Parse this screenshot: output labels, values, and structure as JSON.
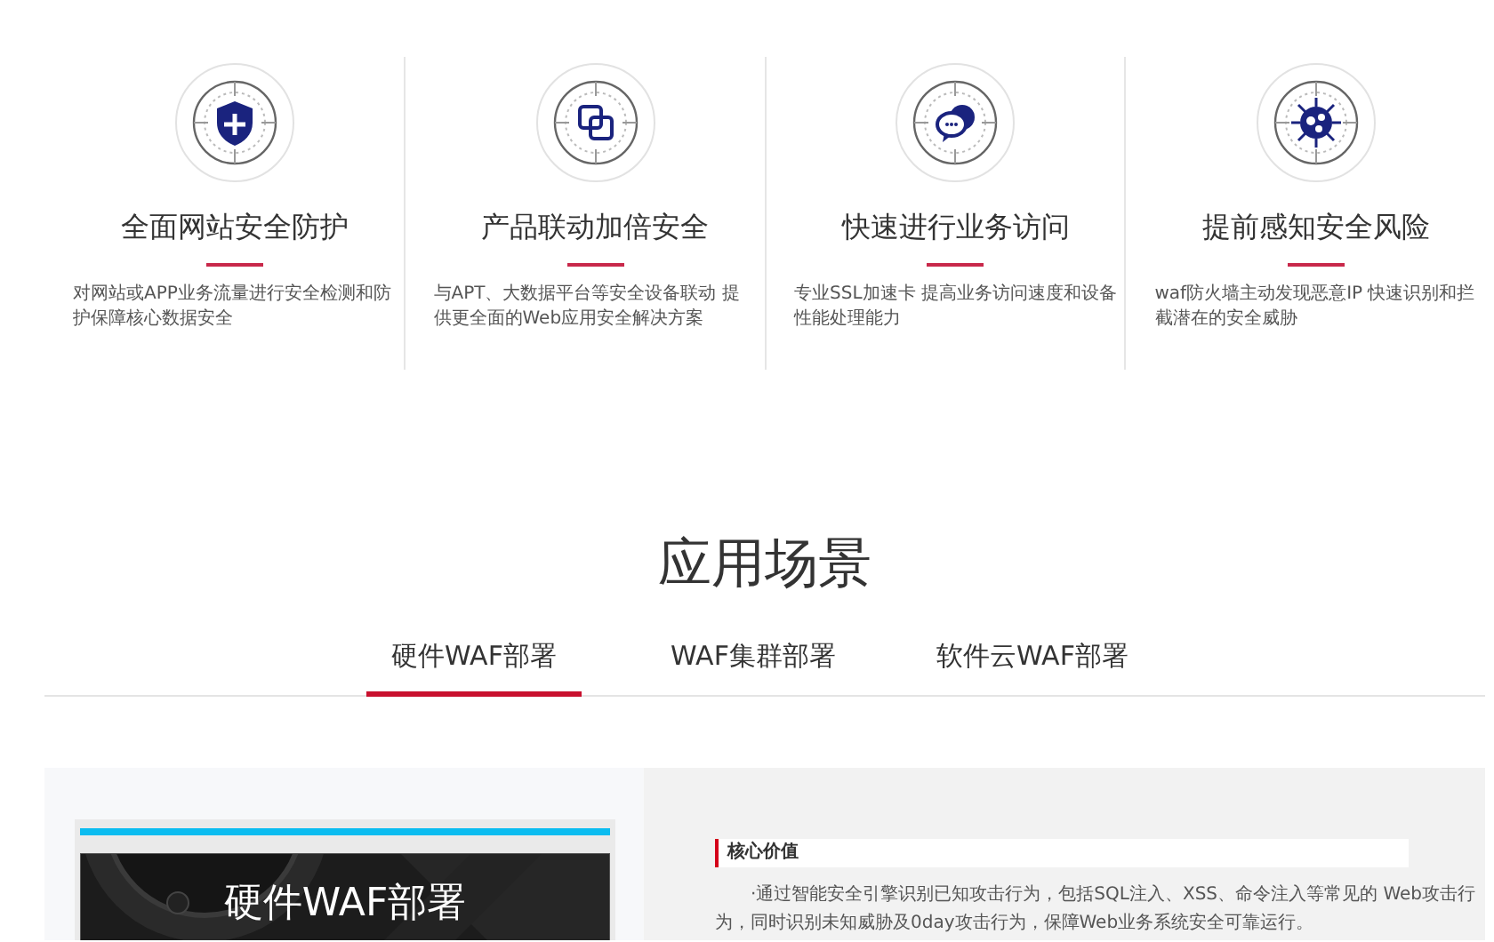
{
  "features": [
    {
      "title": "全面网站安全防护",
      "description": "对网站或APP业务流量进行安全检测和防护保障核心数据安全"
    },
    {
      "title": "产品联动加倍安全",
      "description": "与APT、大数据平台等安全设备联动 提供更全面的Web应用安全解决方案"
    },
    {
      "title": "快速进行业务访问",
      "description": "专业SSL加速卡 提高业务访问速度和设备性能处理能力"
    },
    {
      "title": "提前感知安全风险",
      "description": "waf防火墙主动发现恶意IP 快速识别和拦截潜在的安全威胁"
    }
  ],
  "section_title": "应用场景",
  "tabs": [
    {
      "label": "硬件WAF部署",
      "selected": true
    },
    {
      "label": "WAF集群部署",
      "selected": false
    },
    {
      "label": "软件云WAF部署",
      "selected": false
    }
  ],
  "panel": {
    "image_caption": "硬件WAF部署",
    "heading": "核心价值",
    "body": "·通过智能安全引擎识别已知攻击行为，包括SQL注入、XSS、命令注入等常见的 Web攻击行为，同时识别未知威胁及0day攻击行为，保障Web业务系统安全可靠运行。"
  }
}
